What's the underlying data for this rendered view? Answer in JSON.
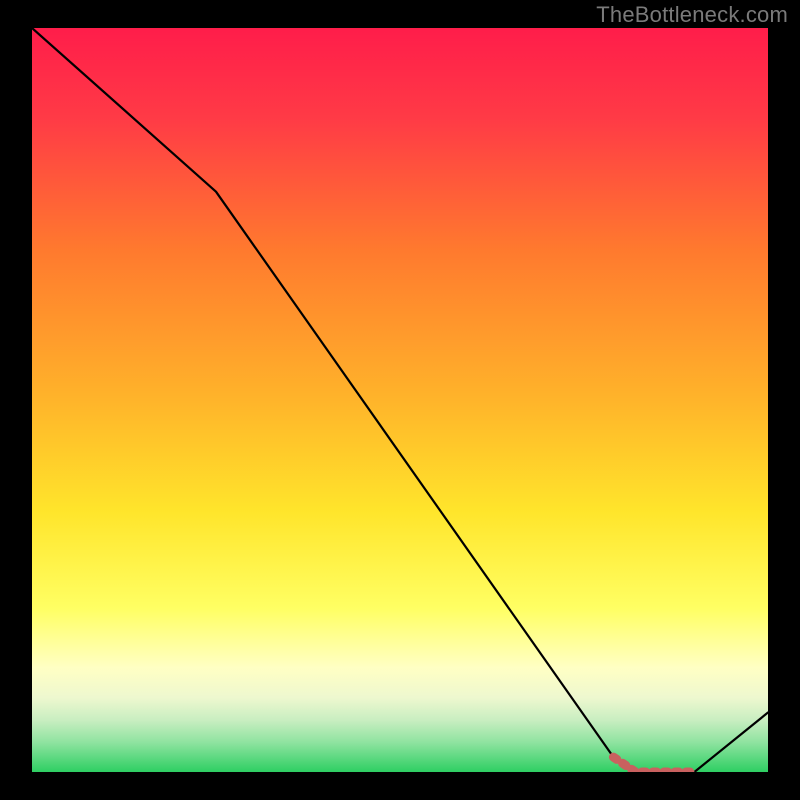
{
  "watermark": "TheBottleneck.com",
  "colors": {
    "bg": "#000000",
    "watermark": "#7a7a7a",
    "line": "#000000",
    "highlight": "#c9615f",
    "gradient": {
      "top": "#ff1d4a",
      "mid1": "#ff7a2e",
      "mid2": "#ffd72b",
      "paleYellow": "#ffffc4",
      "hazeGreen": "#c9eec1",
      "green": "#2ecf63"
    }
  },
  "chart_data": {
    "type": "line",
    "title": "",
    "xlabel": "",
    "ylabel": "",
    "xlim": [
      0,
      100
    ],
    "ylim": [
      0,
      100
    ],
    "grid": false,
    "series": [
      {
        "name": "black-line",
        "x": [
          0,
          25,
          79,
          82,
          90,
          100
        ],
        "values": [
          100,
          78,
          2,
          0,
          0,
          8
        ]
      },
      {
        "name": "highlight-segment",
        "x": [
          79,
          82,
          90
        ],
        "values": [
          2,
          0,
          0
        ]
      }
    ]
  }
}
